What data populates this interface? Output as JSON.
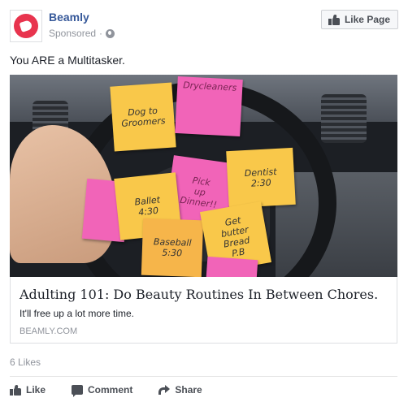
{
  "header": {
    "page_name": "Beamly",
    "sponsored": "Sponsored",
    "separator": "·",
    "like_page_label": "Like Page"
  },
  "post": {
    "message": "You ARE a Multitasker."
  },
  "image": {
    "notes": [
      "Dog to\nGroomers",
      "Drycleaners",
      "Pick\nup\nDinner!!",
      "Dentist\n2:30",
      "Ballet\n4:30",
      "Baseball\n5:30",
      "Get\nbutter\nBread\nP.B"
    ]
  },
  "link": {
    "headline": "Adulting 101: Do Beauty Routines In Between Chores.",
    "description": "It'll free up a lot more time.",
    "domain": "BEAMLY.COM"
  },
  "stats": {
    "likes": "6 Likes"
  },
  "actions": {
    "like": "Like",
    "comment": "Comment",
    "share": "Share"
  },
  "icons": {
    "avatar": "beamly-logo",
    "audience": "globe-icon",
    "like": "thumbs-up-icon",
    "comment": "comment-icon",
    "share": "share-icon"
  },
  "colors": {
    "brand": "#e8344e",
    "link_blue": "#365899",
    "muted": "#90949c",
    "note_yellow": "#f9c84a",
    "note_pink": "#f164b8"
  }
}
